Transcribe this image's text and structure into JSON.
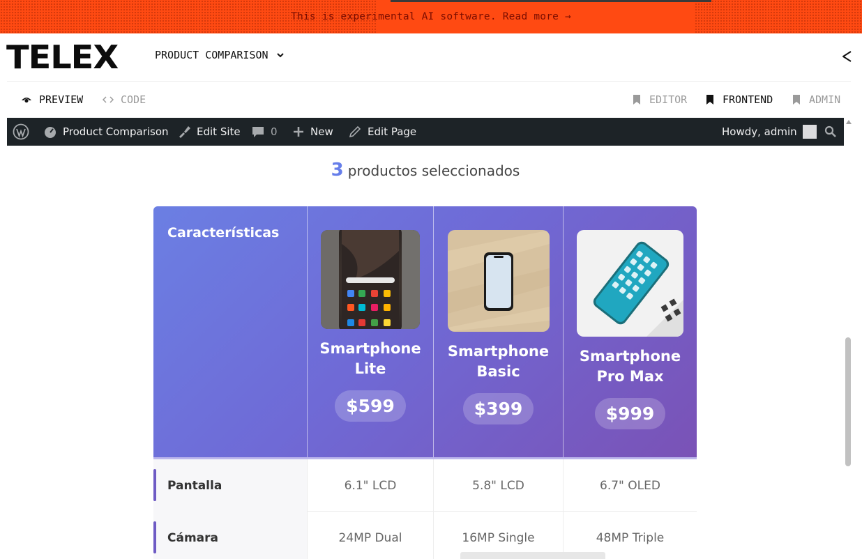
{
  "banner": {
    "text": "This is experimental AI software. Read more →",
    "color": "#ff4a12"
  },
  "header": {
    "logo": "TELEX",
    "title": "PRODUCT COMPARISON"
  },
  "tabs": {
    "preview": "PREVIEW",
    "code": "CODE",
    "editor": "EDITOR",
    "frontend": "FRONTEND",
    "admin": "ADMIN"
  },
  "wpbar": {
    "site_name": "Product Comparison",
    "edit_site": "Edit Site",
    "comments_count": "0",
    "new_label": "New",
    "edit_page": "Edit Page",
    "howdy": "Howdy, admin"
  },
  "main": {
    "count_number": "3",
    "count_text": "productos seleccionados",
    "features_header": "Características",
    "accent_color": "#667eea",
    "products": [
      {
        "name_line1": "Smartphone",
        "name_line2": "Lite",
        "price": "$599"
      },
      {
        "name_line1": "Smartphone",
        "name_line2": "Basic",
        "price": "$399"
      },
      {
        "name_line1": "Smartphone",
        "name_line2": "Pro Max",
        "price": "$999"
      }
    ],
    "rows": [
      {
        "label": "Pantalla",
        "values": [
          "6.1\" LCD",
          "5.8\" LCD",
          "6.7\" OLED"
        ]
      },
      {
        "label": "Cámara",
        "values": [
          "24MP Dual",
          "16MP Single",
          "48MP Triple"
        ]
      }
    ]
  }
}
